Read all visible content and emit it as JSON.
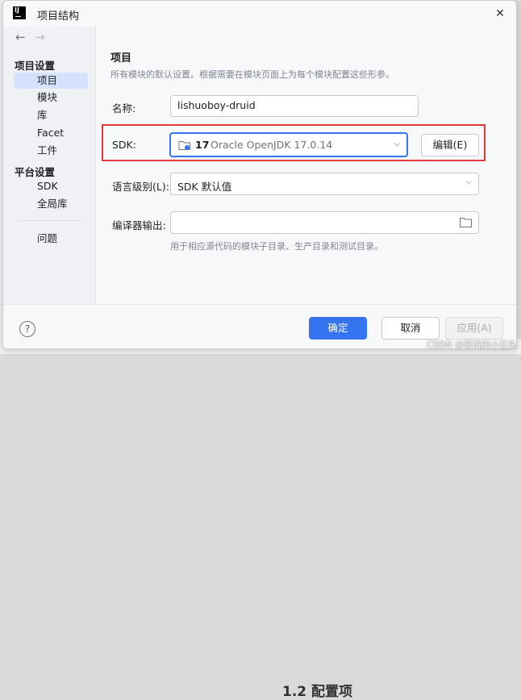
{
  "window": {
    "title": "项目结构",
    "close_glyph": "✕"
  },
  "nav": {
    "back": "←",
    "forward": "→"
  },
  "sidebar": {
    "section1": "项目设置",
    "items1": [
      "项目",
      "模块",
      "库",
      "Facet",
      "工件"
    ],
    "section2": "平台设置",
    "items2": [
      "SDK",
      "全局库"
    ],
    "items3": [
      "问题"
    ],
    "selected": "项目"
  },
  "content": {
    "heading": "项目",
    "description": "所有模块的默认设置。根据需要在模块页面上为每个模块配置这些形参。",
    "name_label": "名称:",
    "name_value": "lishuoboy-druid",
    "sdk_label": "SDK:",
    "sdk_version": "17",
    "sdk_name": "Oracle OpenJDK 17.0.14",
    "edit_button": "编辑(E)",
    "lang_label": "语言级别(L):",
    "lang_value": "SDK 默认值",
    "compiler_label": "编译器输出:",
    "compiler_value": "",
    "compiler_hint": "用于相应源代码的模块子目录、生产目录和测试目录。"
  },
  "footer": {
    "help": "?",
    "ok": "确定",
    "cancel": "取消",
    "apply": "应用(A)"
  },
  "background": {
    "heading_fragment": "1.2 配置项",
    "watermark": "CSDN @笨坑的小石头"
  },
  "icons": {
    "app": "intellij-logo-icon",
    "close": "close-icon",
    "sdk": "jdk-folder-icon",
    "browse": "folder-icon",
    "chevron": "chevron-down-icon"
  },
  "colors": {
    "accent": "#3574f0",
    "selected_row": "#d4e2ff",
    "highlight_box": "#e23a3a"
  }
}
